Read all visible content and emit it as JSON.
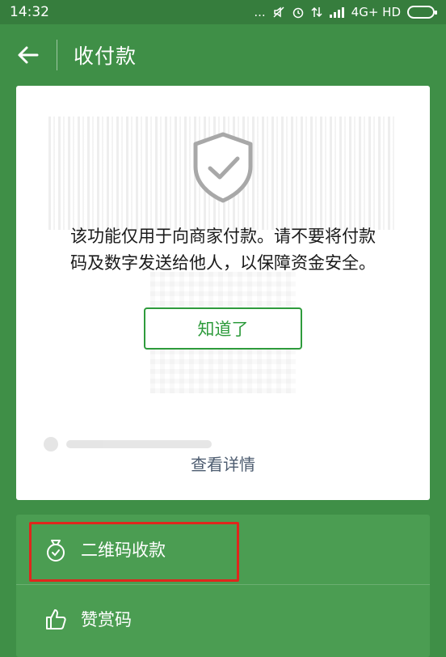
{
  "status_bar": {
    "time": "14:32",
    "network": "4G+ HD",
    "dots": "..."
  },
  "header": {
    "title": "收付款",
    "back_icon": "back-arrow-icon"
  },
  "card": {
    "icon": "shield-check-icon",
    "message_line1": "该功能仅用于向商家付款。请不要将付款",
    "message_line2": "码及数字发送给他人，以保障资金安全。",
    "ack_label": "知道了",
    "details_label": "查看详情"
  },
  "menu": {
    "items": [
      {
        "label": "二维码收款",
        "icon": "money-bag-icon"
      },
      {
        "label": "赞赏码",
        "icon": "thumbs-up-icon"
      }
    ]
  },
  "colors": {
    "background": "#3f8f47",
    "accent": "#2e9b3c",
    "highlight": "#e0261c"
  }
}
